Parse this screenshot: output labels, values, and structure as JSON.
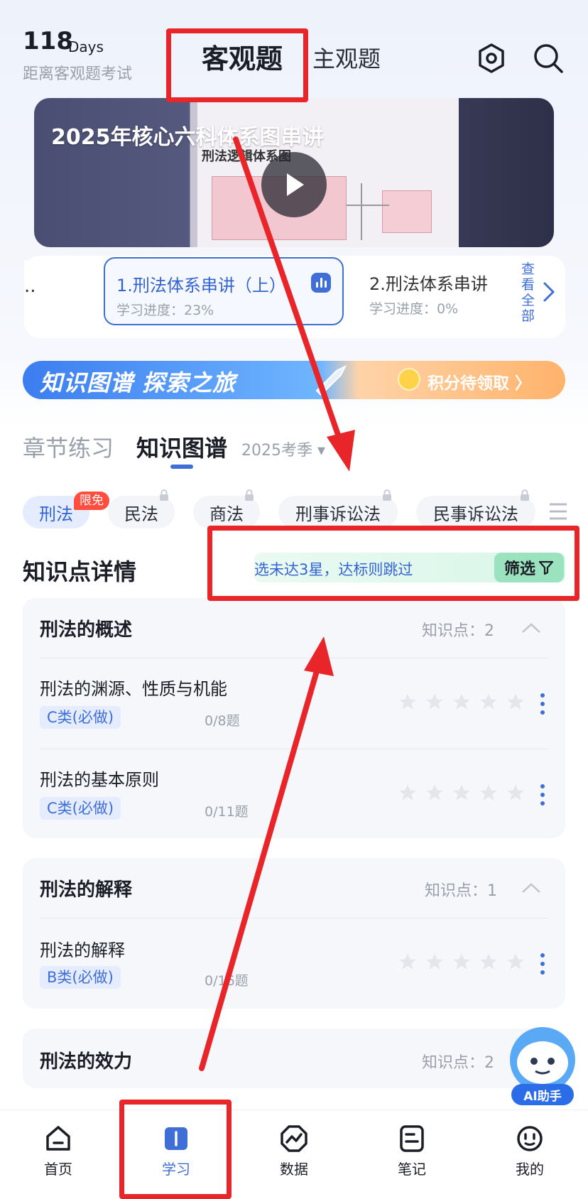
{
  "header": {
    "days_number": "118",
    "days_unit": "Days",
    "days_caption": "距离客观题考试",
    "tab_objective": "客观题",
    "tab_subjective": "主观题"
  },
  "banner": {
    "title": "2025年核心六科体系图串讲",
    "doc_title": "刑法逻辑体系图"
  },
  "lessons": {
    "prev_label": "..",
    "items": [
      {
        "title": "1.刑法体系串讲（上）",
        "progress": "学习进度：23%"
      },
      {
        "title": "2.刑法体系串讲",
        "progress": "学习进度：0%"
      }
    ],
    "see_all": "查看全部"
  },
  "promo": {
    "left_text": "知识图谱 探索之旅",
    "right_text": "积分待领取 〉"
  },
  "section_tabs": {
    "tab1": "章节练习",
    "tab2": "知识图谱",
    "season": "2025考季 ▾"
  },
  "subjects": {
    "free_badge": "限免",
    "items": [
      "刑法",
      "民法",
      "商法",
      "刑事诉讼法",
      "民事诉讼法"
    ]
  },
  "knowledge": {
    "title": "知识点详情",
    "filter_hint": "选未达3星，达标则跳过",
    "filter_button": "筛选",
    "groups": [
      {
        "title": "刑法的概述",
        "count": "知识点：2",
        "items": [
          {
            "title": "刑法的渊源、性质与机能",
            "tag": "C类(必做)",
            "questions": "0/8题"
          },
          {
            "title": "刑法的基本原则",
            "tag": "C类(必做)",
            "questions": "0/11题"
          }
        ]
      },
      {
        "title": "刑法的解释",
        "count": "知识点：1",
        "items": [
          {
            "title": "刑法的解释",
            "tag": "B类(必做)",
            "questions": "0/16题"
          }
        ]
      },
      {
        "title": "刑法的效力",
        "count": "知识点：2",
        "items": []
      }
    ]
  },
  "ai_assistant": {
    "label": "AI助手"
  },
  "nav": {
    "items": [
      "首页",
      "学习",
      "数据",
      "笔记",
      "我的"
    ],
    "active_index": 1
  },
  "colors": {
    "accent": "#3f6fd6",
    "annotation_red": "#e8262a",
    "filter_green": "#9be3bf"
  }
}
